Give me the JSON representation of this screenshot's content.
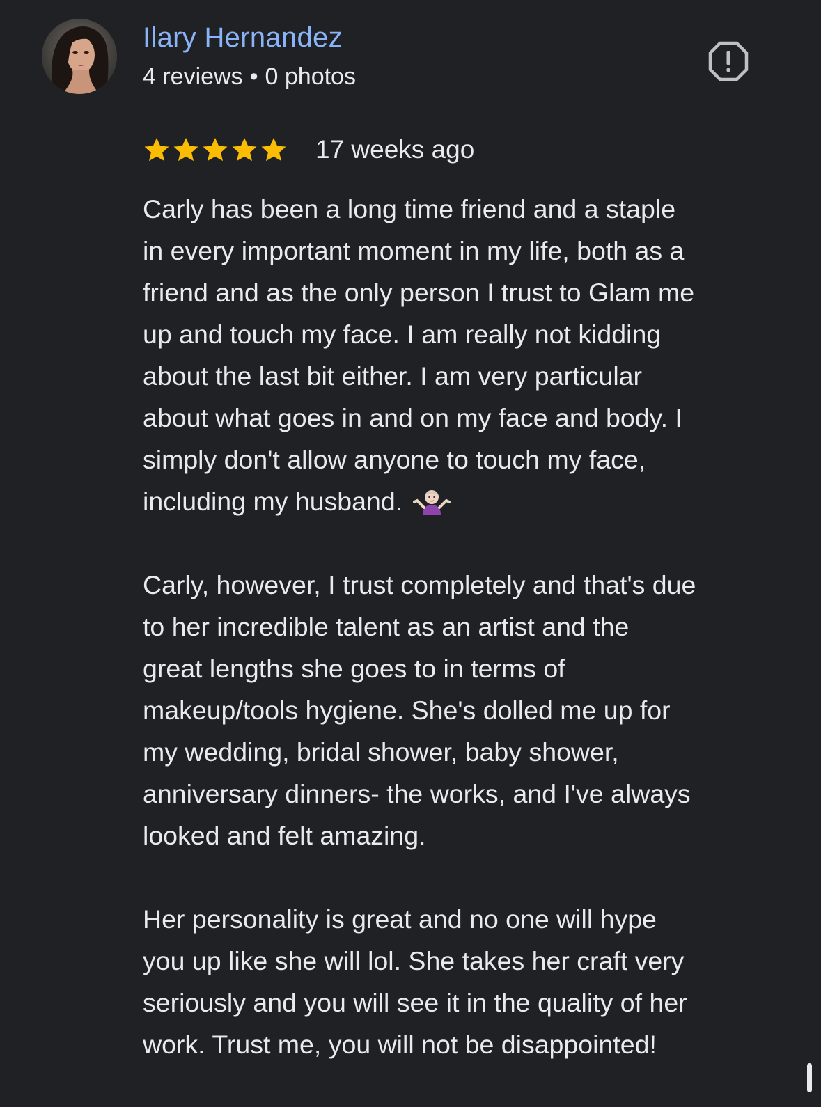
{
  "review": {
    "author_name": "Ilary Hernandez",
    "reviews_count": "4 reviews",
    "separator": "•",
    "photos_count": "0 photos",
    "rating": 5,
    "rating_max": 5,
    "time": "17 weeks ago",
    "star_color": "#fbbc04",
    "name_color": "#8ab4f8",
    "paragraphs": [
      {
        "lines": [
          "Carly has been a long time friend and a staple",
          "in every important moment in my life, both as a",
          "friend and as the only person I trust to Glam me",
          "up and touch my face. I am really not kidding",
          "about the last bit either. I am very particular",
          "about what goes in and on my face and body. I",
          "simply don't allow anyone to touch my face,",
          "including my husband."
        ],
        "trailing_emoji": "person-shrugging-emoji"
      },
      {
        "lines": [
          "Carly, however, I trust completely and that's due",
          "to her incredible talent as an artist and the",
          "great lengths she goes to in terms of",
          "makeup/tools hygiene. She's dolled me up for",
          "my wedding, bridal shower, baby shower,",
          "anniversary dinners- the works, and I've always",
          "looked and felt amazing."
        ]
      },
      {
        "lines": [
          "Her personality is great and no one will hype",
          "you up like she will lol. She takes her craft very",
          "seriously and you will see it in the quality of her",
          "work. Trust me, you will not be disappointed!"
        ]
      }
    ]
  },
  "icons": {
    "report": "report-flag-icon",
    "avatar": "avatar"
  }
}
